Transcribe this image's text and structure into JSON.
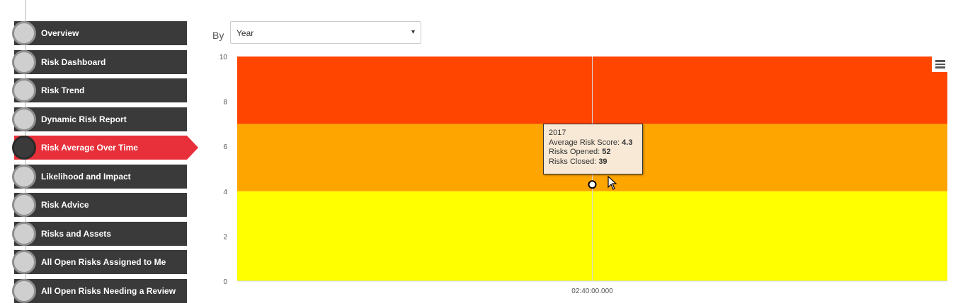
{
  "sidebar": {
    "items": [
      {
        "label": "Overview",
        "active": false
      },
      {
        "label": "Risk Dashboard",
        "active": false
      },
      {
        "label": "Risk Trend",
        "active": false
      },
      {
        "label": "Dynamic Risk Report",
        "active": false
      },
      {
        "label": "Risk Average Over Time",
        "active": true
      },
      {
        "label": "Likelihood and Impact",
        "active": false
      },
      {
        "label": "Risk Advice",
        "active": false
      },
      {
        "label": "Risks and Assets",
        "active": false
      },
      {
        "label": "All Open Risks Assigned to Me",
        "active": false
      },
      {
        "label": "All Open Risks Needing a Review",
        "active": false
      }
    ]
  },
  "filter": {
    "by_label": "By",
    "selected": "Year"
  },
  "chart_data": {
    "type": "line",
    "x_tick_labels": [
      "02:40:00.000"
    ],
    "y_ticks": [
      0,
      2,
      4,
      6,
      8,
      10
    ],
    "ylim": [
      0,
      10
    ],
    "bands": [
      {
        "from": 0,
        "to": 4,
        "color": "#ffff00"
      },
      {
        "from": 4,
        "to": 7,
        "color": "#ffa500"
      },
      {
        "from": 7,
        "to": 10,
        "color": "#ff4500"
      }
    ],
    "points": [
      {
        "x": 0.5,
        "y": 4.3
      }
    ],
    "tooltip": {
      "title": "2017",
      "avg_label": "Average Risk Score:",
      "avg_value": "4.3",
      "opened_label": "Risks Opened:",
      "opened_value": "52",
      "closed_label": "Risks Closed:",
      "closed_value": "39"
    }
  },
  "icons": {
    "menu": "hamburger-menu-icon",
    "caret": "▾",
    "cursor": "mouse-pointer-icon"
  }
}
